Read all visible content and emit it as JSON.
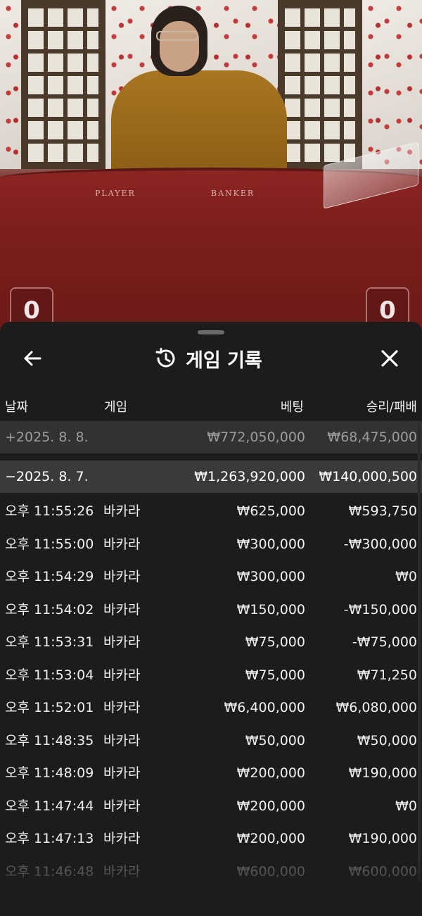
{
  "video": {
    "table_labels": {
      "player": "PLAYER",
      "banker": "BANKER"
    },
    "scores": {
      "player": "0",
      "banker": "0"
    }
  },
  "sheet": {
    "title": "게임 기록",
    "icons": {
      "back": "arrow-left-icon",
      "history": "history-icon",
      "close": "close-icon"
    },
    "columns": {
      "date": "날짜",
      "game": "게임",
      "bet": "베팅",
      "win_loss": "승리/패배"
    },
    "days": [
      {
        "label": "+2025. 8. 8.",
        "bet": "₩772,050,000",
        "win_loss": "₩68,475,000",
        "expanded": false
      },
      {
        "label": "−2025. 8. 7.",
        "bet": "₩1,263,920,000",
        "win_loss": "₩140,000,500",
        "expanded": true
      }
    ],
    "rows": [
      {
        "time": "오후 11:55:26",
        "game": "바카라",
        "bet": "₩625,000",
        "win_loss": "₩593,750"
      },
      {
        "time": "오후 11:55:00",
        "game": "바카라",
        "bet": "₩300,000",
        "win_loss": "-₩300,000"
      },
      {
        "time": "오후 11:54:29",
        "game": "바카라",
        "bet": "₩300,000",
        "win_loss": "₩0"
      },
      {
        "time": "오후 11:54:02",
        "game": "바카라",
        "bet": "₩150,000",
        "win_loss": "-₩150,000"
      },
      {
        "time": "오후 11:53:31",
        "game": "바카라",
        "bet": "₩75,000",
        "win_loss": "-₩75,000"
      },
      {
        "time": "오후 11:53:04",
        "game": "바카라",
        "bet": "₩75,000",
        "win_loss": "₩71,250"
      },
      {
        "time": "오후 11:52:01",
        "game": "바카라",
        "bet": "₩6,400,000",
        "win_loss": "₩6,080,000"
      },
      {
        "time": "오후 11:48:35",
        "game": "바카라",
        "bet": "₩50,000",
        "win_loss": "₩50,000"
      },
      {
        "time": "오후 11:48:09",
        "game": "바카라",
        "bet": "₩200,000",
        "win_loss": "₩190,000"
      },
      {
        "time": "오후 11:47:44",
        "game": "바카라",
        "bet": "₩200,000",
        "win_loss": "₩0"
      },
      {
        "time": "오후 11:47:13",
        "game": "바카라",
        "bet": "₩200,000",
        "win_loss": "₩190,000"
      },
      {
        "time": "오후 11:46:48",
        "game": "바카라",
        "bet": "₩600,000",
        "win_loss": "₩600,000"
      }
    ]
  }
}
